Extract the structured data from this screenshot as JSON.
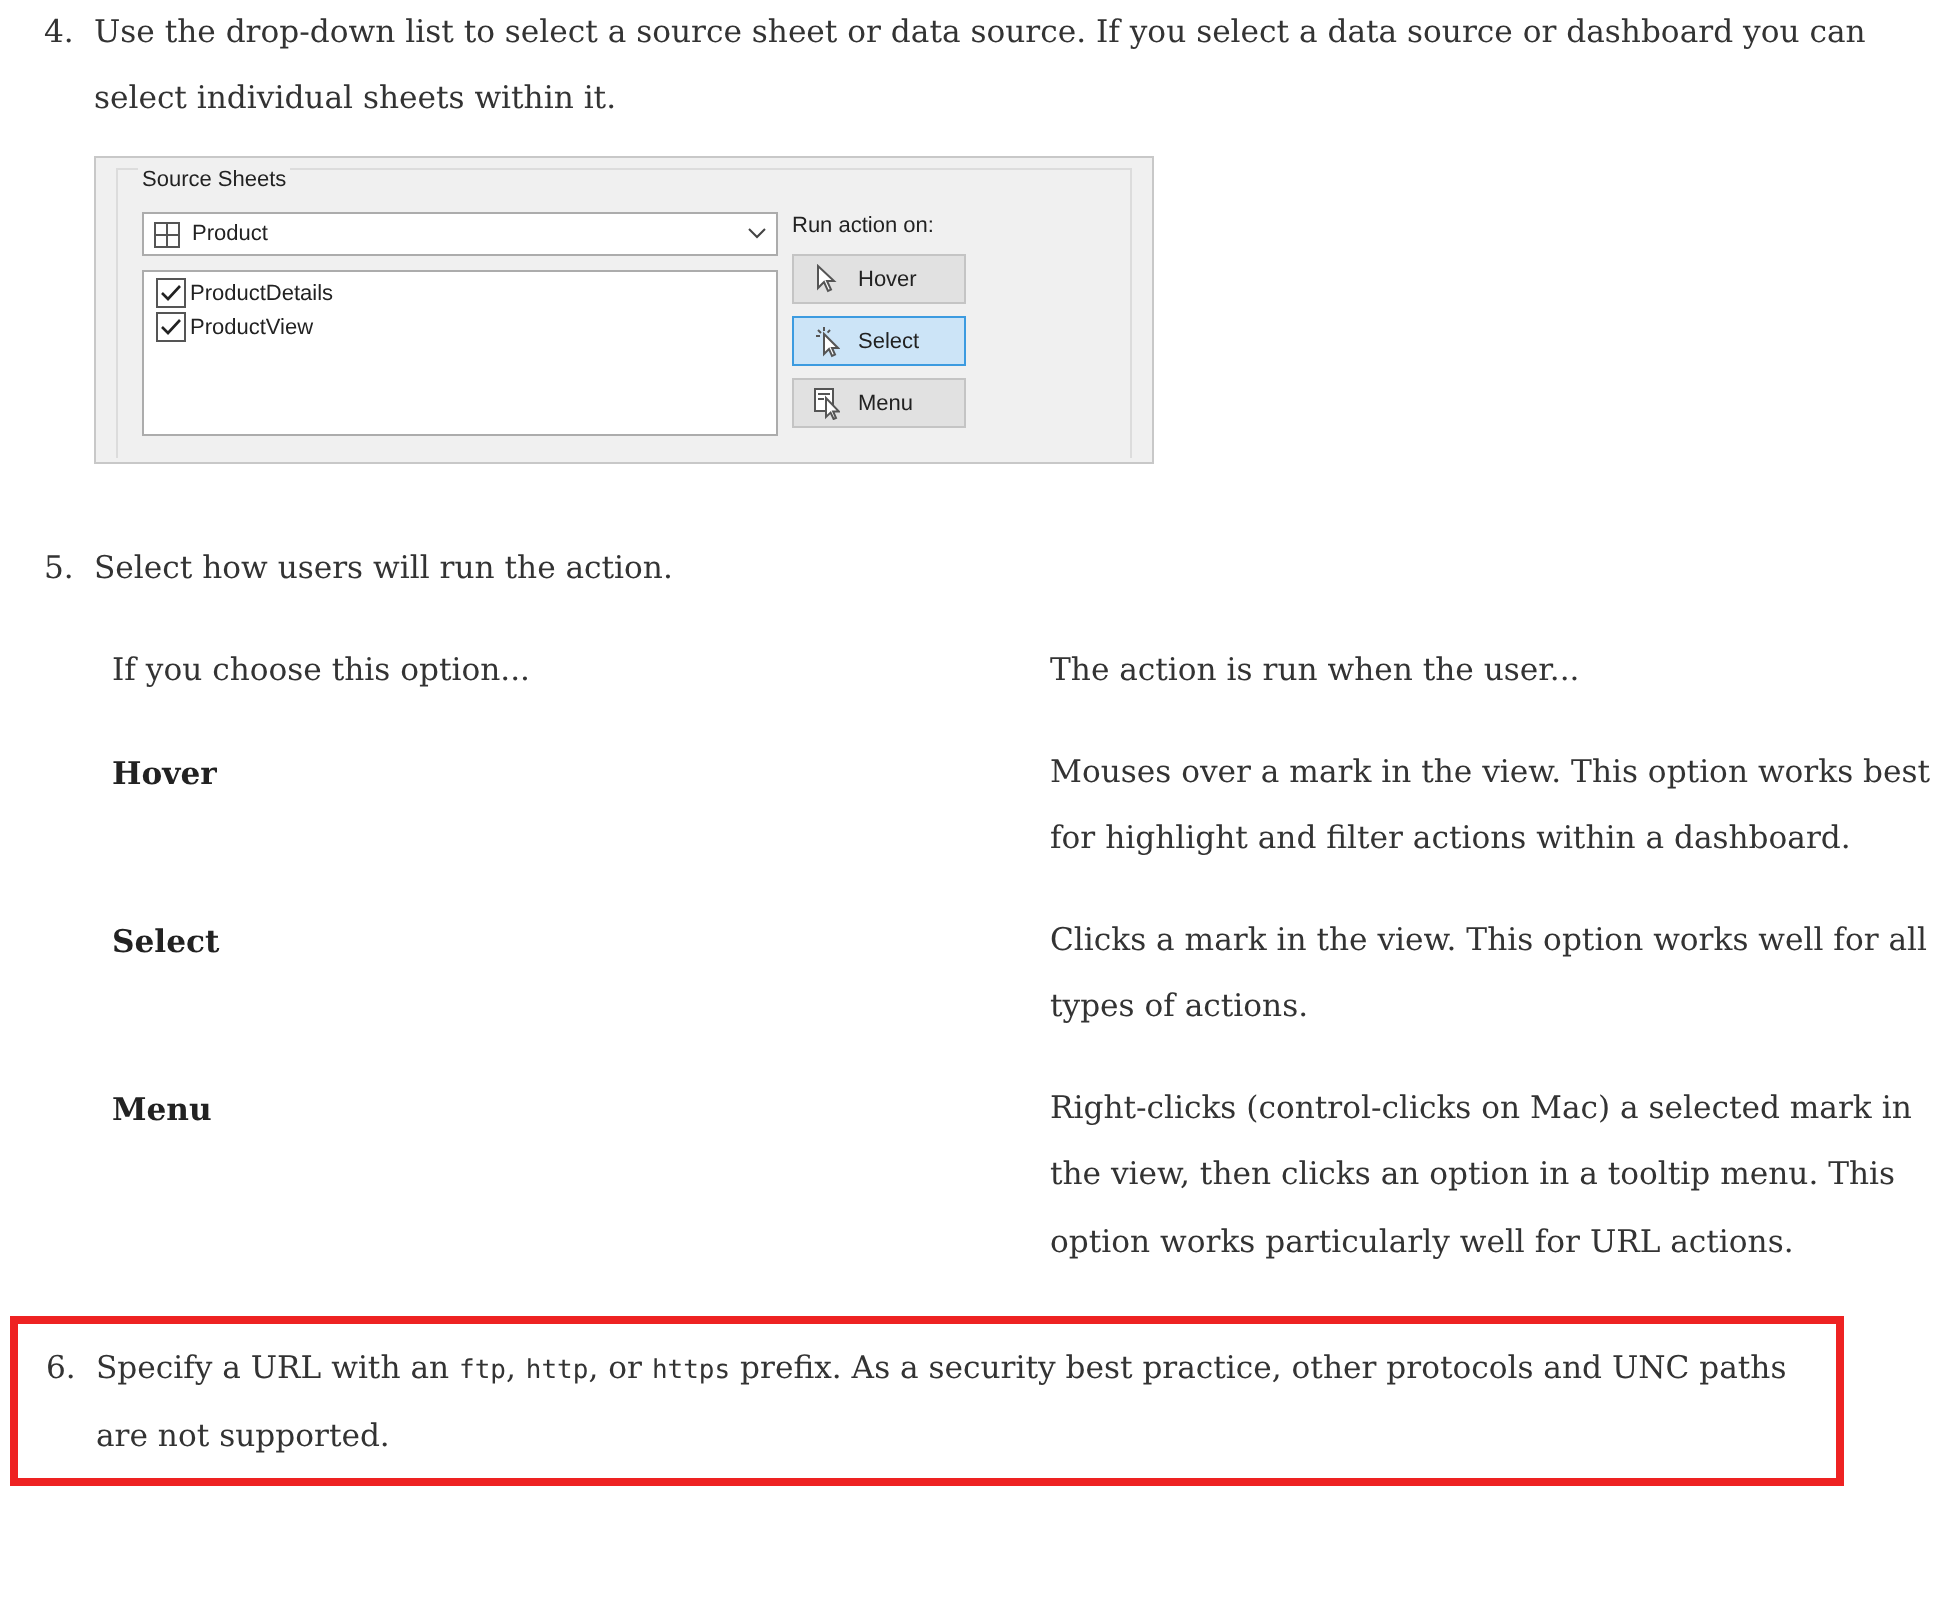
{
  "step_4": {
    "number": "4.",
    "text": "Use the drop-down list to select a source sheet or data source. If you select a data source or dashboard you can select individual sheets within it.",
    "dialog": {
      "group_title": "Source Sheets",
      "dropdown": {
        "value": "Product"
      },
      "sheets": [
        {
          "label": "ProductDetails",
          "checked": true
        },
        {
          "label": "ProductView",
          "checked": true
        }
      ],
      "run_action_label": "Run action on:",
      "buttons": [
        {
          "label": "Hover",
          "selected": false
        },
        {
          "label": "Select",
          "selected": true
        },
        {
          "label": "Menu",
          "selected": false
        }
      ]
    }
  },
  "step_5": {
    "number": "5.",
    "text": "Select how users will run the action.",
    "table": {
      "columns": [
        "If you choose this option...",
        "The action is run when the user..."
      ],
      "rows": [
        {
          "option": "Hover",
          "description": "Mouses over a mark in the view. This option works best for highlight and filter actions within a dashboard."
        },
        {
          "option": "Select",
          "description": "Clicks a mark in the view. This option works well for all types of actions."
        },
        {
          "option": "Menu",
          "description": "Right-clicks (control-clicks on Mac) a selected mark in the view, then clicks an option in a tooltip menu. This option works particularly well for URL actions."
        }
      ]
    }
  },
  "step_6": {
    "number": "6.",
    "highlighted": true,
    "parts": [
      {
        "kind": "text",
        "text": "Specify a URL with an "
      },
      {
        "kind": "code",
        "text": "ftp"
      },
      {
        "kind": "text",
        "text": ", "
      },
      {
        "kind": "code",
        "text": "http"
      },
      {
        "kind": "text",
        "text": ", or "
      },
      {
        "kind": "code",
        "text": "https"
      },
      {
        "kind": "text",
        "text": " prefix. As a security best practice, other protocols and UNC paths are not supported."
      }
    ]
  }
}
